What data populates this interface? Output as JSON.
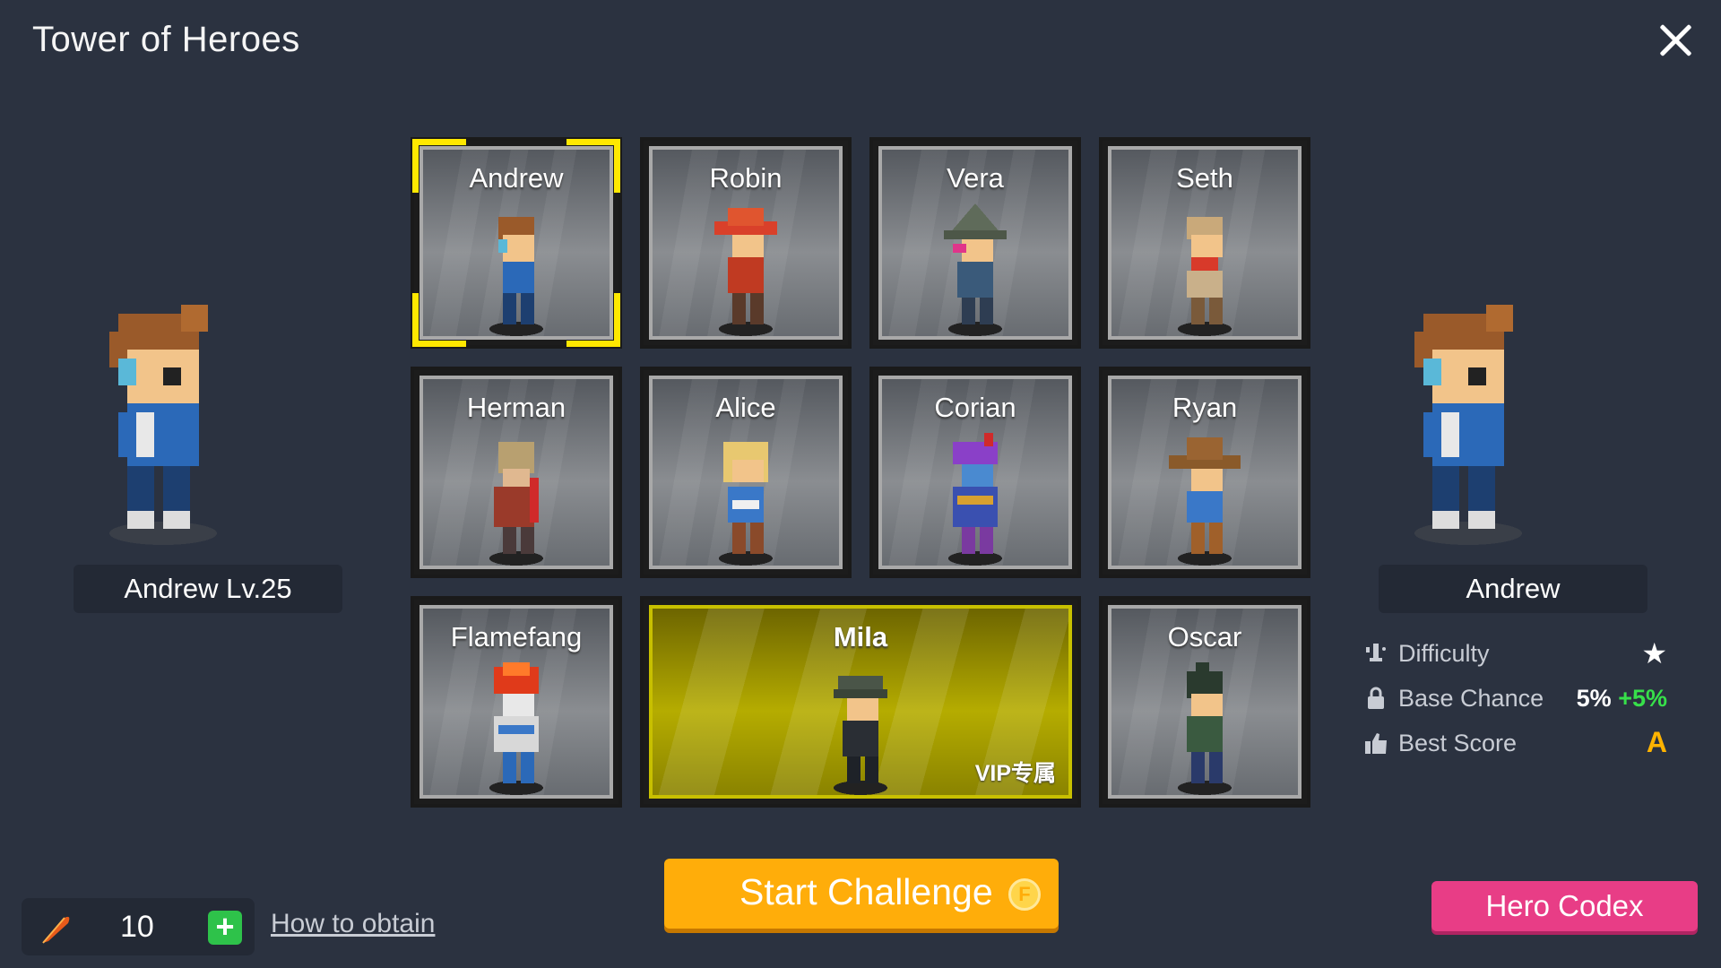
{
  "window": {
    "title": "Tower of Heroes"
  },
  "left_preview": {
    "label": "Andrew Lv.25"
  },
  "right_preview": {
    "label": "Andrew",
    "stats": [
      {
        "icon": "trophy-icon",
        "label": "Difficulty",
        "value": "★",
        "bonus": ""
      },
      {
        "icon": "lock-icon",
        "label": "Base Chance",
        "value": "5%",
        "bonus": "+5%"
      },
      {
        "icon": "thumbs-up-icon",
        "label": "Best Score",
        "value": "A",
        "bonus": ""
      }
    ]
  },
  "heroes": [
    {
      "name": "Andrew",
      "selected": true,
      "vip": false
    },
    {
      "name": "Robin",
      "selected": false,
      "vip": false
    },
    {
      "name": "Vera",
      "selected": false,
      "vip": false
    },
    {
      "name": "Seth",
      "selected": false,
      "vip": false
    },
    {
      "name": "Herman",
      "selected": false,
      "vip": false
    },
    {
      "name": "Alice",
      "selected": false,
      "vip": false
    },
    {
      "name": "Corian",
      "selected": false,
      "vip": false
    },
    {
      "name": "Ryan",
      "selected": false,
      "vip": false
    },
    {
      "name": "Flamefang",
      "selected": false,
      "vip": false
    },
    {
      "name": "Mila",
      "selected": false,
      "vip": true,
      "tag": "VIP专属"
    },
    {
      "name": "Oscar",
      "selected": false,
      "vip": false
    }
  ],
  "actions": {
    "start_label": "Start Challenge",
    "coin_label": "F",
    "codex_label": "Hero Codex"
  },
  "resource": {
    "icon": "feather-icon",
    "count": "10",
    "add_label": "+",
    "obtain_label": "How to obtain"
  },
  "colors": {
    "background": "#2b3240",
    "selected_frame": "#ffe800",
    "vip_card": "#b5ac00",
    "start_button": "#ffad0a",
    "codex_button": "#e83d86",
    "bonus": "#37e04a"
  }
}
